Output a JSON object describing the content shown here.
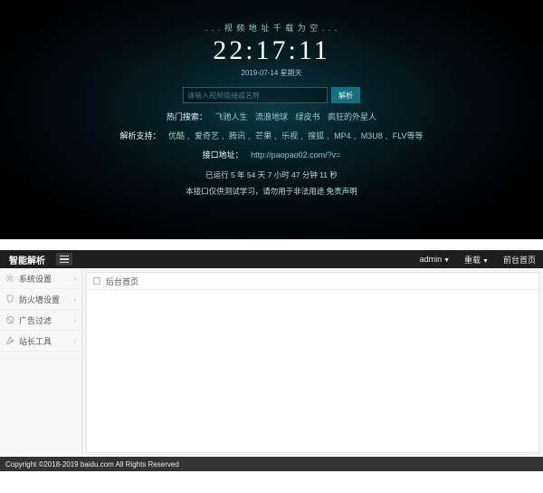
{
  "top": {
    "tagline": ". . . 视 频 地 址 千 载 为 空 . . .",
    "clock": "22:17:11",
    "date": "2019-07-14 星期天",
    "search": {
      "placeholder": "请输入视频链接或名称",
      "button": "解析"
    },
    "hot": {
      "label": "热门搜索：",
      "items": [
        "飞驰人生",
        "流浪地球",
        "绿皮书",
        "疯狂的外星人"
      ]
    },
    "support": {
      "label": "解析支持：",
      "items": [
        "优酷",
        "爱奇艺",
        "腾讯",
        "芒果",
        "乐视",
        "搜狐",
        "MP4",
        "M3U8",
        "FLV等等"
      ]
    },
    "api": {
      "label": "接口地址：",
      "url": "http://paopao02.com/?v="
    },
    "uptime": "已运行 5 年 54 天 7 小时 47 分钟 11 秒",
    "disclaimer_a": "本接口仅供测试学习，请勿用于非法用途 ",
    "disclaimer_b": "免责声明"
  },
  "admin": {
    "brand": "智能解析",
    "user": "admin",
    "menu": [
      "系统设置",
      "防火墙设置",
      "广告过滤",
      "站长工具"
    ],
    "crumb": "后台首页",
    "topnav": {
      "reset": "重载",
      "home": "前台首页"
    }
  },
  "footer": "Copyright ©2018-2019 baidu.com All Rights Reserved"
}
